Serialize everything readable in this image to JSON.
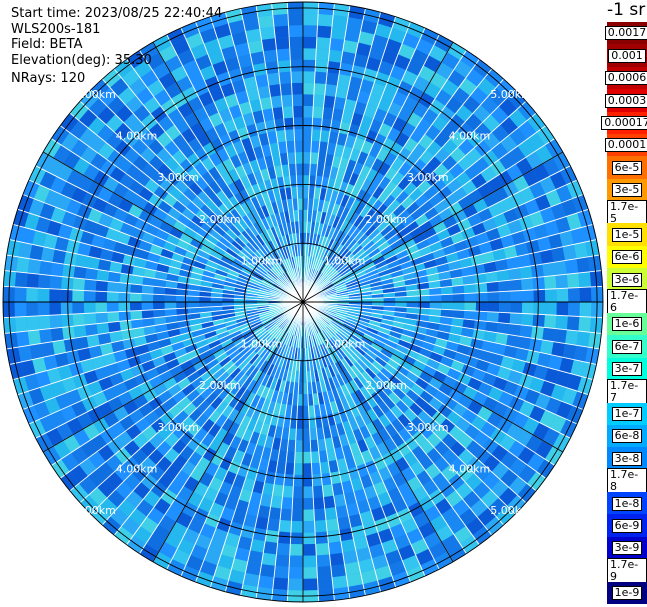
{
  "info": {
    "start_time": "Start time: 2023/08/25 22:40:44",
    "instrument": "WLS200s-181",
    "field": "Field: BETA",
    "elevation": "Elevation(deg): 35.30",
    "nrays": "NRays: 120"
  },
  "colorbar": {
    "unit_label": "-1 sr",
    "entries": [
      {
        "label": "0.0017",
        "color": "#8b0000"
      },
      {
        "label": "0.001",
        "color": "#a00000"
      },
      {
        "label": "0.0006",
        "color": "#c00000"
      },
      {
        "label": "0.0003",
        "color": "#e00000"
      },
      {
        "label": "0.00017",
        "color": "#ff2000"
      },
      {
        "label": "0.0001",
        "color": "#ff4000"
      },
      {
        "label": "6e-5",
        "color": "#ff7000"
      },
      {
        "label": "3e-5",
        "color": "#ff9900"
      },
      {
        "label": "1.7e-5",
        "color": "#ffc000"
      },
      {
        "label": "1e-5",
        "color": "#ffe000"
      },
      {
        "label": "6e-6",
        "color": "#ffff00"
      },
      {
        "label": "3e-6",
        "color": "#ccff33"
      },
      {
        "label": "1.7e-6",
        "color": "#99ff66"
      },
      {
        "label": "1e-6",
        "color": "#66ff99"
      },
      {
        "label": "6e-7",
        "color": "#33ffcc"
      },
      {
        "label": "3e-7",
        "color": "#00ffdd"
      },
      {
        "label": "1.7e-7",
        "color": "#00eeff"
      },
      {
        "label": "1e-7",
        "color": "#00ccff"
      },
      {
        "label": "6e-8",
        "color": "#00aaff"
      },
      {
        "label": "3e-8",
        "color": "#0088ff"
      },
      {
        "label": "1.7e-8",
        "color": "#0066ff"
      },
      {
        "label": "1e-8",
        "color": "#0044ff"
      },
      {
        "label": "6e-9",
        "color": "#0022ee"
      },
      {
        "label": "3e-9",
        "color": "#0000cc"
      },
      {
        "label": "1.7e-9",
        "color": "#0000a0"
      },
      {
        "label": "1e-9",
        "color": "#000080"
      }
    ]
  },
  "chart_data": {
    "type": "heatmap",
    "projection": "polar PPI",
    "range_rings_km": [
      1.0,
      2.0,
      3.0,
      4.0,
      5.0
    ],
    "range_ring_labels": [
      "1.00km",
      "2.00km",
      "3.00km",
      "4.00km",
      "5.00km"
    ],
    "azimuth_spokes_deg": [
      0,
      30,
      60,
      90,
      120,
      150,
      180,
      210,
      240,
      270,
      300,
      330
    ],
    "n_rays": 120,
    "max_range_km": 5.1,
    "field": "BETA",
    "palette_range": [
      "1e-9",
      "0.0017"
    ],
    "dominant_values": [
      "1e-8",
      "6e-8",
      "1.7e-7"
    ]
  }
}
